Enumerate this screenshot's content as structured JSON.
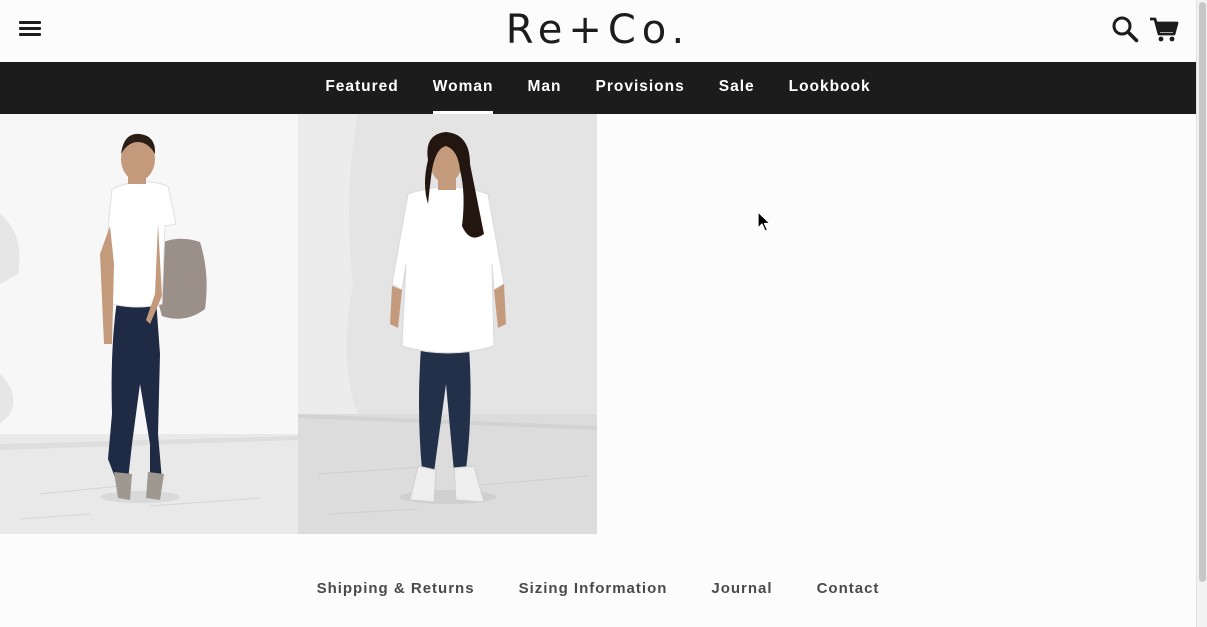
{
  "header": {
    "logo_text": "Re+Co.",
    "menu_icon": "hamburger-menu-icon",
    "search_icon": "search-icon",
    "cart_icon": "cart-icon"
  },
  "nav": {
    "items": [
      {
        "label": "Featured",
        "active": false
      },
      {
        "label": "Woman",
        "active": true
      },
      {
        "label": "Man",
        "active": false
      },
      {
        "label": "Provisions",
        "active": false
      },
      {
        "label": "Sale",
        "active": false
      },
      {
        "label": "Lookbook",
        "active": false
      }
    ]
  },
  "products": [
    {
      "image": "woman-with-backpack-photo"
    },
    {
      "image": "woman-in-white-shirt-photo"
    }
  ],
  "footer": {
    "links": [
      "Shipping & Returns",
      "Sizing Information",
      "Journal",
      "Contact"
    ]
  },
  "colors": {
    "background": "#fcfcfc",
    "nav_background": "#1c1c1c",
    "nav_text": "#ffffff",
    "footer_text": "#4a4a4a"
  }
}
